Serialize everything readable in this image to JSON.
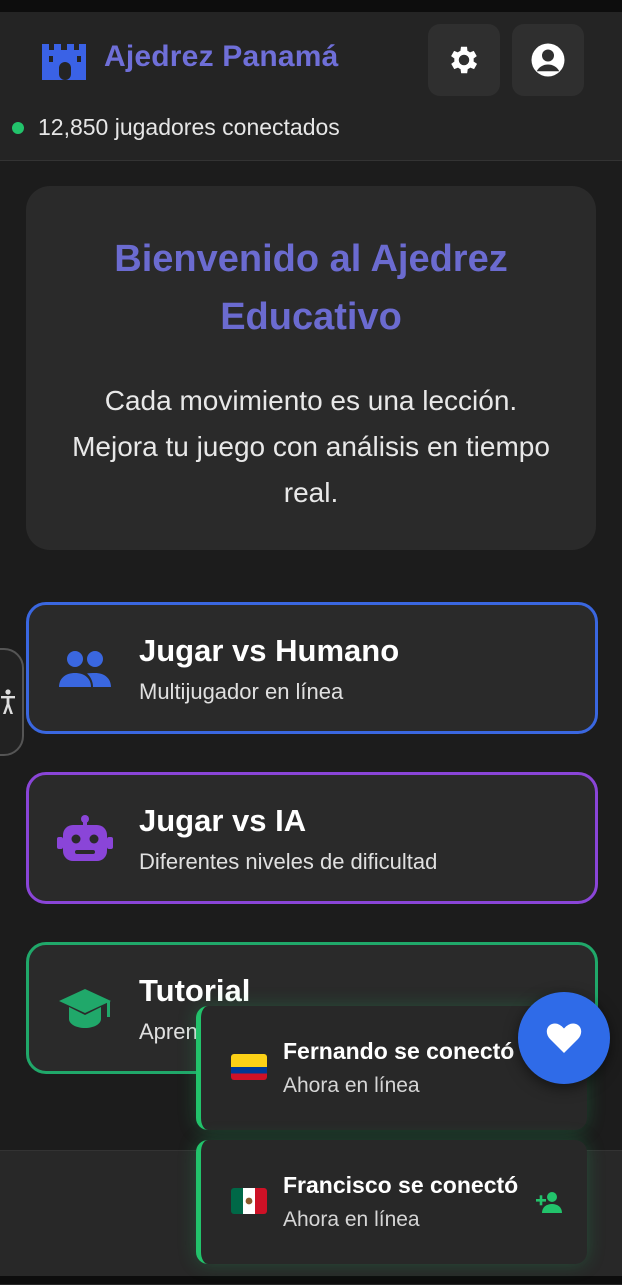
{
  "header": {
    "app_title": "Ajedrez Panamá",
    "online_text": "12,850 jugadores conectados",
    "logo_icon": "castle-icon",
    "settings_icon": "gear-icon",
    "profile_icon": "user-circle-icon"
  },
  "welcome": {
    "title": "Bienvenido al Ajedrez Educativo",
    "text": "Cada movimiento es una lección. Mejora tu juego con análisis en tiempo real."
  },
  "modes": [
    {
      "title": "Jugar vs Humano",
      "subtitle": "Multijugador en línea",
      "icon": "users-icon",
      "color": "#3a67e0"
    },
    {
      "title": "Jugar vs IA",
      "subtitle": "Diferentes niveles de dificultad",
      "icon": "robot-icon",
      "color": "#8a45d8"
    },
    {
      "title": "Tutorial",
      "subtitle": "Apren",
      "icon": "graduation-cap-icon",
      "color": "#20a86a"
    }
  ],
  "notifications": [
    {
      "title": "Fernando se conectó",
      "subtitle": "Ahora en línea",
      "flag": "colombia-flag-icon"
    },
    {
      "title": "Francisco se conectó",
      "subtitle": "Ahora en línea",
      "flag": "mexico-flag-icon"
    }
  ],
  "fab": {
    "icon": "heart-icon",
    "color": "#2f6be8"
  },
  "accessibility": {
    "icon": "accessibility-icon"
  },
  "colors": {
    "accent": "#6f6fd8",
    "online": "#22c36b",
    "background": "#1c1c1c"
  }
}
